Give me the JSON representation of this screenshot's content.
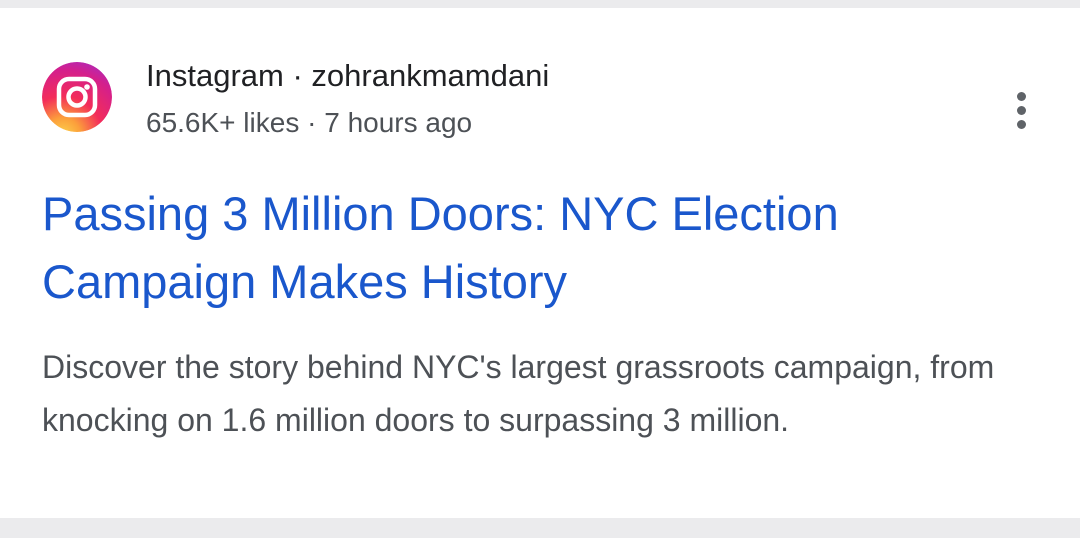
{
  "result": {
    "source": "Instagram",
    "separator": "·",
    "account": "zohrankmamdani",
    "likes": "65.6K+ likes",
    "time": "7 hours ago",
    "title": "Passing 3 Million Doors: NYC Election Campaign Makes History",
    "snippet": "Discover the story behind NYC's largest grassroots campaign, from knocking on 1.6 million doors to surpassing 3 million.",
    "logo_icon": "instagram-logo-icon",
    "menu_icon": "more-vert-icon"
  },
  "colors": {
    "title_link": "#1a57cc",
    "snippet_text": "#4d5156",
    "background": "#ebebed",
    "card": "#ffffff"
  }
}
